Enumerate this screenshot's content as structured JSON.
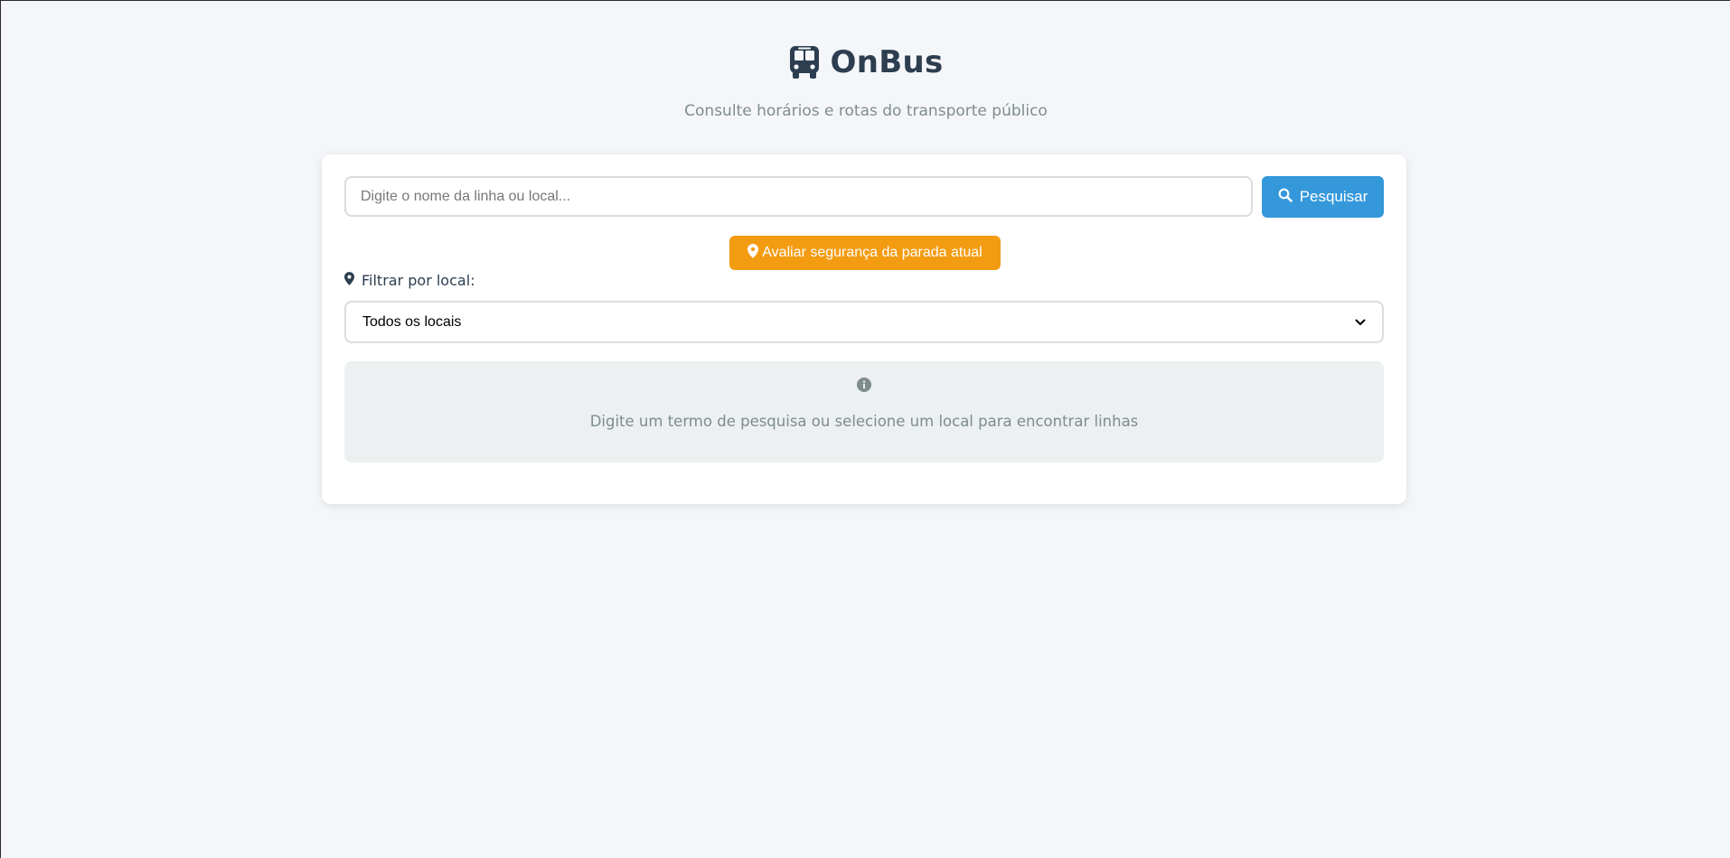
{
  "header": {
    "brand_name": "OnBus",
    "subtitle": "Consulte horários e rotas do transporte público",
    "brand_icon": "bus-icon"
  },
  "search": {
    "placeholder": "Digite o nome da linha ou local...",
    "value": "",
    "button_label": "Pesquisar",
    "button_icon": "search-icon"
  },
  "safety": {
    "button_label": "Avaliar segurança da parada atual",
    "button_icon": "map-marker-icon"
  },
  "filter": {
    "label": "Filtrar por local:",
    "label_icon": "map-marker-icon",
    "selected": "Todos os locais"
  },
  "empty_state": {
    "icon": "info-icon",
    "message": "Digite um termo de pesquisa ou selecione um local para encontrar linhas"
  },
  "colors": {
    "primary": "#3498db",
    "warning": "#f39c12",
    "text_dark": "#2c3e50",
    "text_muted": "#7f8c8d",
    "background": "#f4f6f9"
  }
}
